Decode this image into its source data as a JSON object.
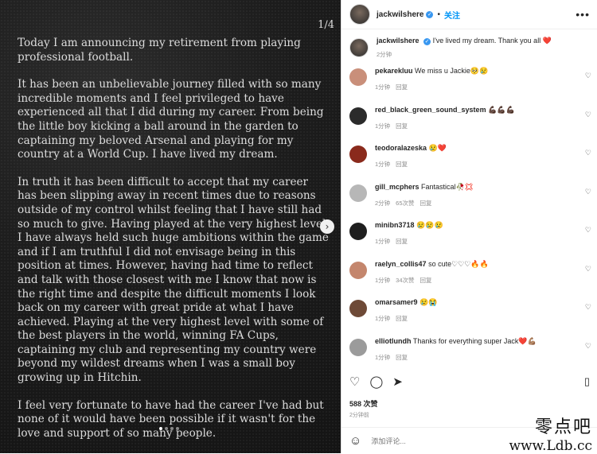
{
  "post": {
    "counter": "1/4",
    "paragraphs": [
      "Today I am announcing my retirement from playing professional football.",
      "It has been an unbelievable journey filled with so many incredible moments and I feel privileged to have experienced all that I did during my career. From being the little boy kicking a ball around in the garden to captaining my beloved Arsenal and playing for my country at a World Cup. I have lived my dream.",
      "In truth it has been difficult to accept that my career has been slipping away in recent times due to reasons outside of my control whilst feeling that I have still had so much to give. Having played at the very highest level I have always held such huge ambitions within the game and if I am truthful I did not envisage being in this position at times. However, having had time to reflect and talk with those closest with me I know that now is the right time and despite the difficult moments I look back on my career with great pride at what I have achieved. Playing at the very highest level with some of the best players in the world, winning FA Cups, captaining my club and representing my country were beyond my wildest dreams when I was a small boy growing up in Hitchin.",
      "I feel very fortunate to have had the career I've had but none of it would have been possible if it wasn't for the love and support of so many people."
    ],
    "next_icon": "chevron-right-icon",
    "page_dots": 4,
    "active_dot": 0
  },
  "header": {
    "username": "jackwilshere",
    "separator": "•",
    "follow_label": "关注",
    "more_icon": "more-icon"
  },
  "caption": {
    "username": "jackwilshere",
    "text": "I've lived my dream. Thank you all ❤️",
    "time": "2分钟"
  },
  "comments": [
    {
      "user": "pekarekluu",
      "text": "We miss u Jackie🥺😢",
      "time": "1分钟",
      "likes": "",
      "reply": "回复",
      "avatar_color": "#c98f7a"
    },
    {
      "user": "red_black_green_sound_system",
      "text": "💪🏿💪🏿💪🏿",
      "time": "1分钟",
      "likes": "",
      "reply": "回复",
      "avatar_color": "#2b2b2b"
    },
    {
      "user": "teodoralazeska",
      "text": "😢❤️",
      "time": "1分钟",
      "likes": "",
      "reply": "回复",
      "avatar_color": "#8a2a1c"
    },
    {
      "user": "gill_mcphers",
      "text": "Fantastical🥀💢",
      "time": "2分钟",
      "likes": "65次赞",
      "reply": "回复",
      "avatar_color": "#b7b7b7"
    },
    {
      "user": "minibn3718",
      "text": "😢😢😢",
      "time": "1分钟",
      "likes": "",
      "reply": "回复",
      "avatar_color": "#1f1f1f"
    },
    {
      "user": "raelyn_collis47",
      "text": "so cute♡♡♡🔥🔥",
      "time": "1分钟",
      "likes": "34次赞",
      "reply": "回复",
      "avatar_color": "#c4866d"
    },
    {
      "user": "omarsamer9",
      "text": "😢😭",
      "time": "1分钟",
      "likes": "",
      "reply": "回复",
      "avatar_color": "#6e4a37"
    },
    {
      "user": "elliotlundh",
      "text": "Thanks for everything super Jack❤️💪🏽",
      "time": "1分钟",
      "likes": "",
      "reply": "回复",
      "avatar_color": "#9b9b9b"
    }
  ],
  "actions": {
    "like_icon": "heart-icon",
    "comment_icon": "comment-icon",
    "share_icon": "share-icon",
    "save_icon": "bookmark-icon"
  },
  "likes": "588 次赞",
  "time_ago": "2分钟前",
  "add_comment": {
    "placeholder": "添加评论...",
    "emoji_icon": "emoji-icon"
  },
  "watermark": {
    "text_cn": "零点吧",
    "url": "www.Ldb.cc"
  }
}
